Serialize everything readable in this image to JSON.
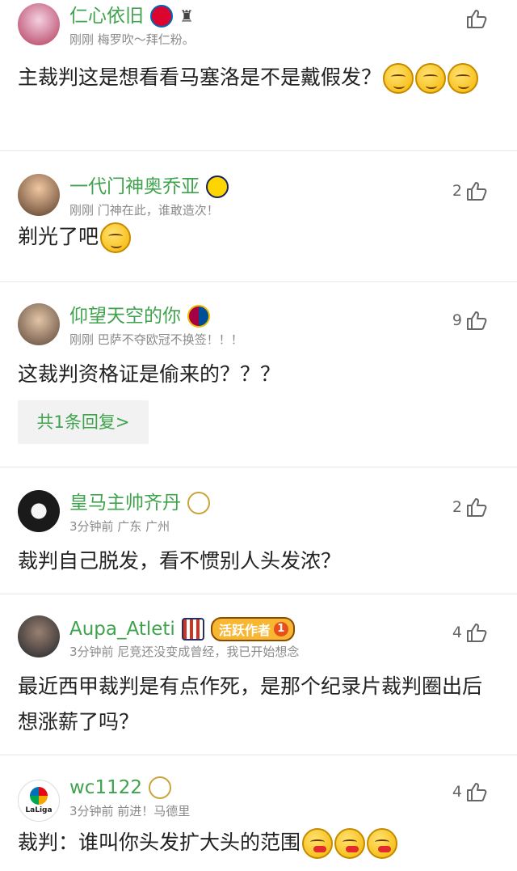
{
  "comments": [
    {
      "name": "仁心依旧",
      "meta": "刚刚  梅罗吹～拜仁粉。",
      "likes": "",
      "text": "主裁判这是想看看马塞洛是不是戴假发？",
      "emojis": 3,
      "badges": [
        "bayern-badge-icon",
        "trophy-icon"
      ]
    },
    {
      "name": "一代门神奥乔亚",
      "meta": "刚刚  门神在此，谁敢造次！",
      "likes": "2",
      "text": "剃光了吧",
      "emojis": 1,
      "badges": [
        "club-america-badge-icon"
      ]
    },
    {
      "name": "仰望天空的你",
      "meta": "刚刚  巴萨不夺欧冠不换签！！！",
      "likes": "9",
      "text": "这裁判资格证是偷来的？？？",
      "reply_label": "共1条回复>",
      "badges": [
        "barcelona-badge-icon"
      ]
    },
    {
      "name": "皇马主帅齐丹",
      "meta": "3分钟前  广东 广州",
      "likes": "2",
      "text": "裁判自己脱发，看不惯别人头发浓？",
      "badges": [
        "real-madrid-badge-icon"
      ]
    },
    {
      "name": "Aupa_Atleti",
      "meta": "3分钟前  尼竞还没变成曾经，我已开始想念",
      "likes": "4",
      "text": "最近西甲裁判是有点作死，是那个纪录片裁判圈出后想涨薪了吗？",
      "active_tag": "活跃作者",
      "active_level": "1",
      "badges": [
        "atletico-badge-icon"
      ]
    },
    {
      "name": "wc1122",
      "meta": "3分钟前  前进！马德里",
      "likes": "4",
      "text": "裁判：谁叫你头发扩大头的范围",
      "emojis": 3,
      "badges": [
        "real-madrid-badge-icon"
      ],
      "avatar_text": "LaLiga"
    }
  ],
  "colors": {
    "name": "#3fa34d",
    "meta": "#8a8a8a",
    "divider": "#e6e6e6"
  }
}
